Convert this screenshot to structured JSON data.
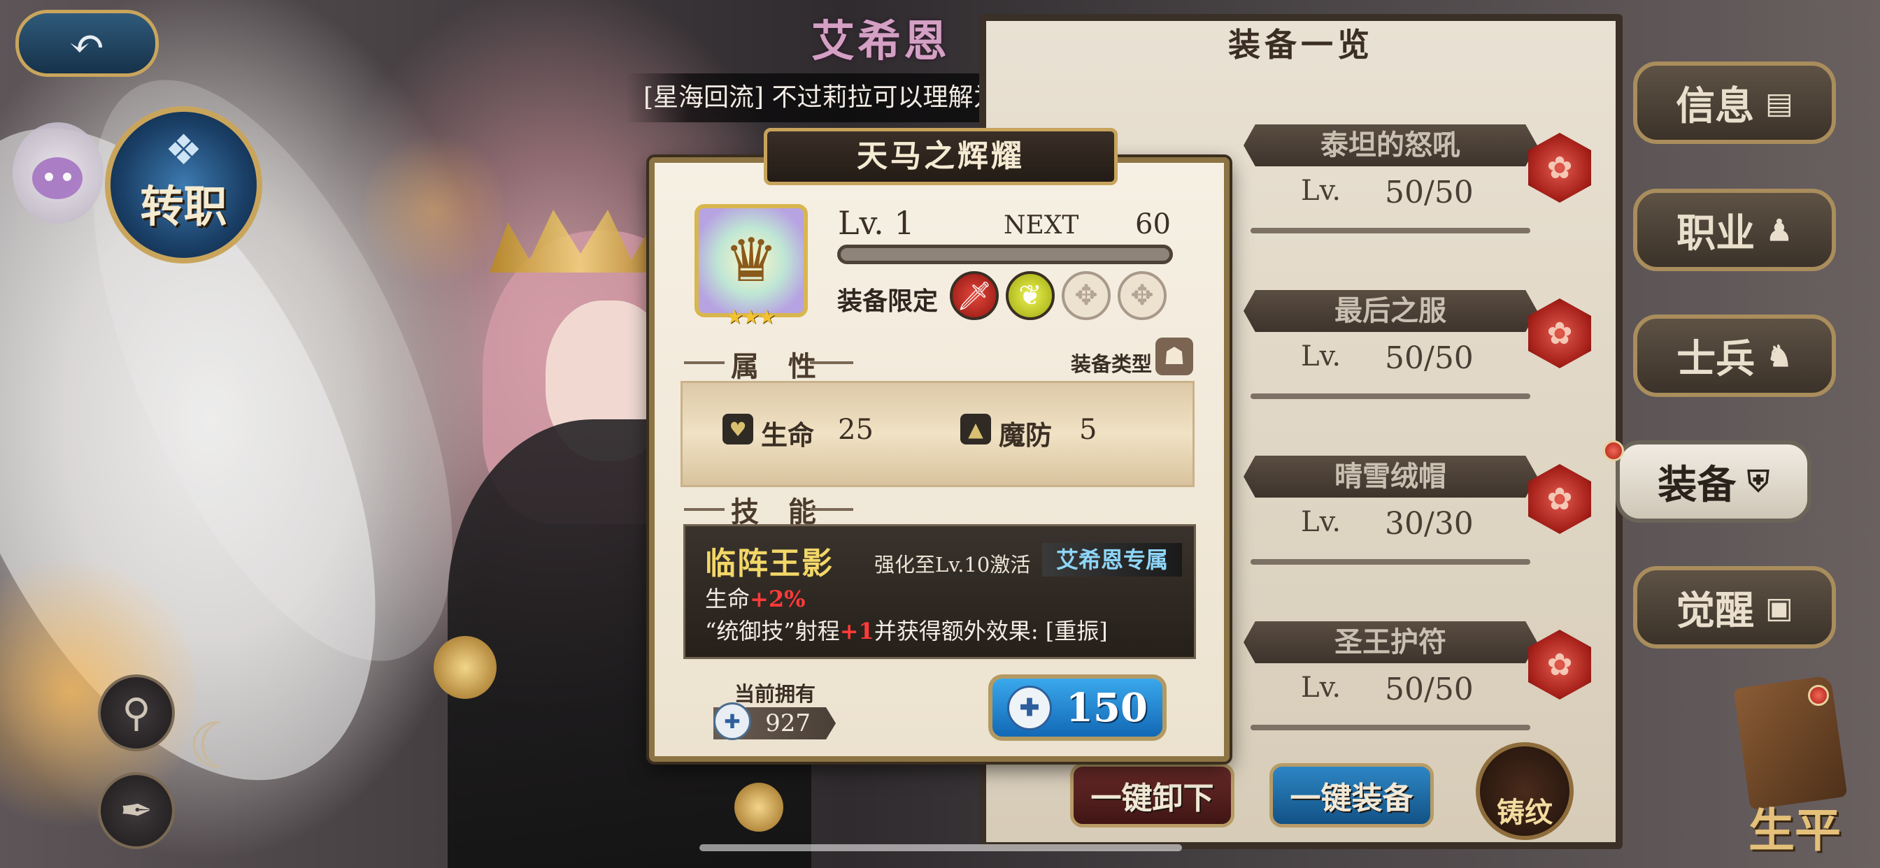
{
  "header": {
    "back_icon": "back-arrow-icon",
    "character_name": "艾希恩",
    "quote": "[星海回流] 不过莉拉可以理解为稍微短腿的西内"
  },
  "left": {
    "job_change_label": "转职",
    "tools": [
      "magnifier-icon",
      "feather-icon"
    ]
  },
  "list": {
    "title": "装备一览",
    "lv_label": "Lv.",
    "items": [
      {
        "name": "泰坦的怒吼",
        "level": "50/50"
      },
      {
        "name": "最后之服",
        "level": "50/50"
      },
      {
        "name": "晴雪绒帽",
        "level": "30/30"
      },
      {
        "name": "圣王护符",
        "level": "50/50"
      }
    ],
    "unequip_label": "一键卸下",
    "auto_equip_label": "一键装备",
    "engrave_label": "铸纹"
  },
  "side_menu": [
    {
      "label": "信息",
      "icon": "document-icon"
    },
    {
      "label": "职业",
      "icon": "person-icon"
    },
    {
      "label": "士兵",
      "icon": "soldier-icon"
    },
    {
      "label": "装备",
      "icon": "shield-icon"
    },
    {
      "label": "觉醒",
      "icon": "portrait-icon"
    }
  ],
  "side_bottom_label": "生平",
  "modal": {
    "title": "天马之辉耀",
    "rarity_stars": "★★★",
    "level": "Lv. 1",
    "next_label": "NEXT",
    "next_value": "60",
    "exp_progress": 0,
    "limit_label": "装备限定",
    "attr_header": "属 性",
    "equip_type_label": "装备类型",
    "attributes": [
      {
        "name": "生命",
        "value": "25"
      },
      {
        "name": "魔防",
        "value": "5"
      }
    ],
    "skill_header": "技 能",
    "skill": {
      "name": "临阵王影",
      "condition": "强化至Lv.10激活",
      "tag": "艾希恩专属",
      "line1_text": "生命",
      "line1_plus": "+2%",
      "line2_pre": "“统御技”射程",
      "line2_plus": "+1",
      "line2_post": "并获得额外效果: [重振]"
    },
    "owned_label": "当前拥有",
    "owned_value": "927",
    "cost_value": "150"
  }
}
